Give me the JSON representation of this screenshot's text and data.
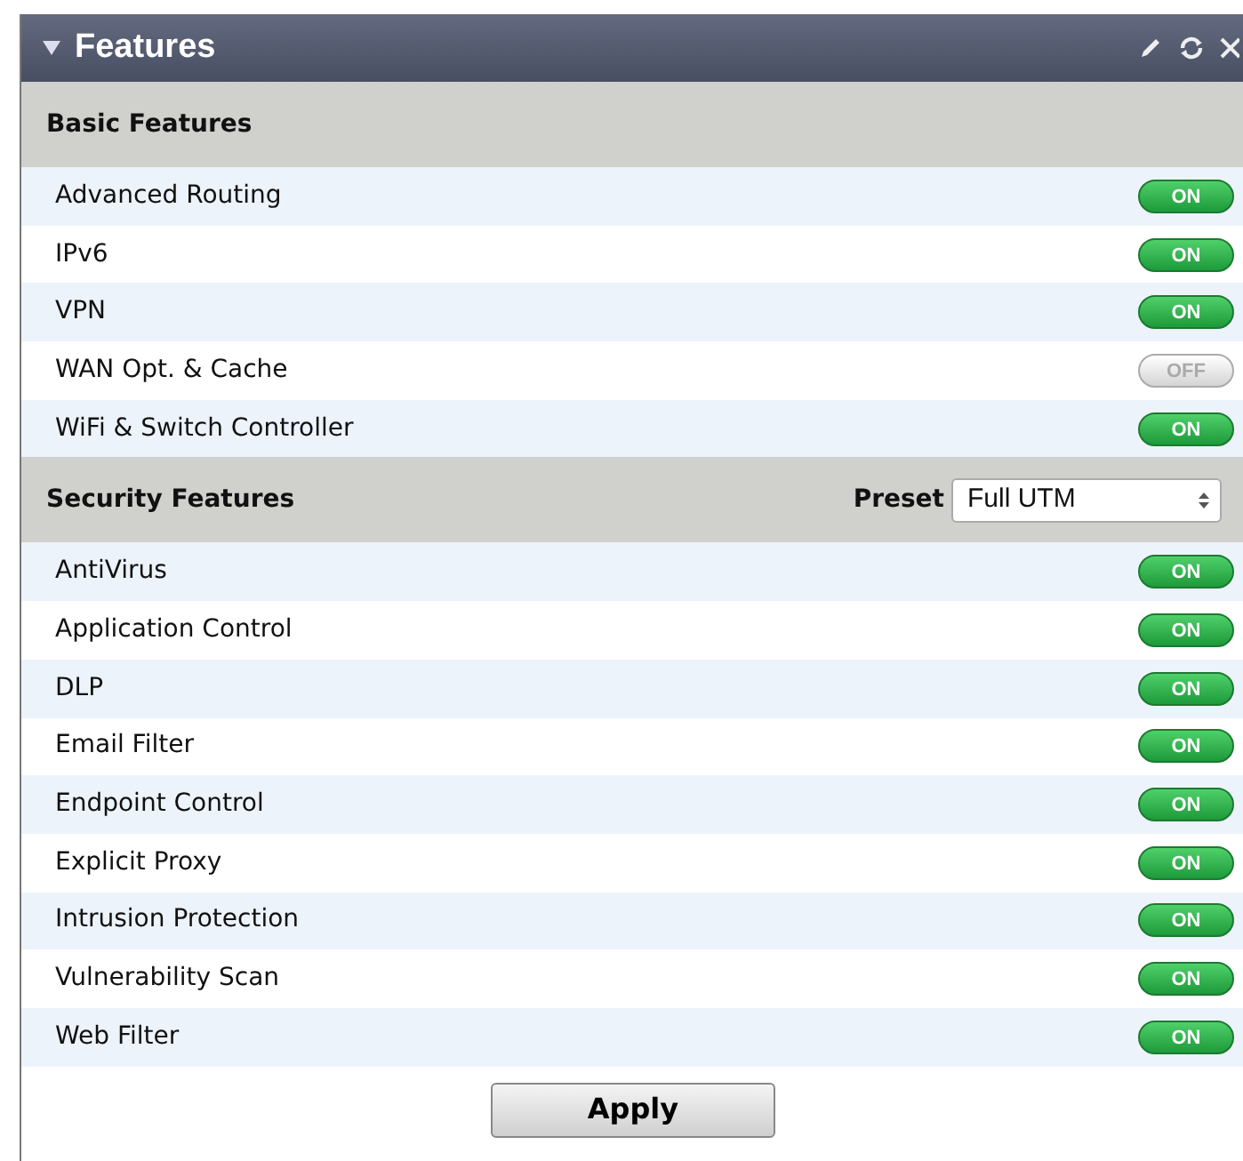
{
  "panel": {
    "title": "Features",
    "expanded": true
  },
  "sections": [
    {
      "title": "Basic Features",
      "features": [
        {
          "name": "Advanced Routing",
          "on": true,
          "toggle_label": "ON"
        },
        {
          "name": "IPv6",
          "on": true,
          "toggle_label": "ON"
        },
        {
          "name": "VPN",
          "on": true,
          "toggle_label": "ON"
        },
        {
          "name": "WAN Opt. & Cache",
          "on": false,
          "toggle_label": "OFF"
        },
        {
          "name": "WiFi & Switch Controller",
          "on": true,
          "toggle_label": "ON"
        }
      ]
    },
    {
      "title": "Security Features",
      "preset": {
        "label": "Preset",
        "value": "Full UTM"
      },
      "features": [
        {
          "name": "AntiVirus",
          "on": true,
          "toggle_label": "ON"
        },
        {
          "name": "Application Control",
          "on": true,
          "toggle_label": "ON"
        },
        {
          "name": "DLP",
          "on": true,
          "toggle_label": "ON"
        },
        {
          "name": "Email Filter",
          "on": true,
          "toggle_label": "ON"
        },
        {
          "name": "Endpoint Control",
          "on": true,
          "toggle_label": "ON"
        },
        {
          "name": "Explicit Proxy",
          "on": true,
          "toggle_label": "ON"
        },
        {
          "name": "Intrusion Protection",
          "on": true,
          "toggle_label": "ON"
        },
        {
          "name": "Vulnerability Scan",
          "on": true,
          "toggle_label": "ON"
        },
        {
          "name": "Web Filter",
          "on": true,
          "toggle_label": "ON"
        }
      ]
    }
  ],
  "apply_button": "Apply"
}
